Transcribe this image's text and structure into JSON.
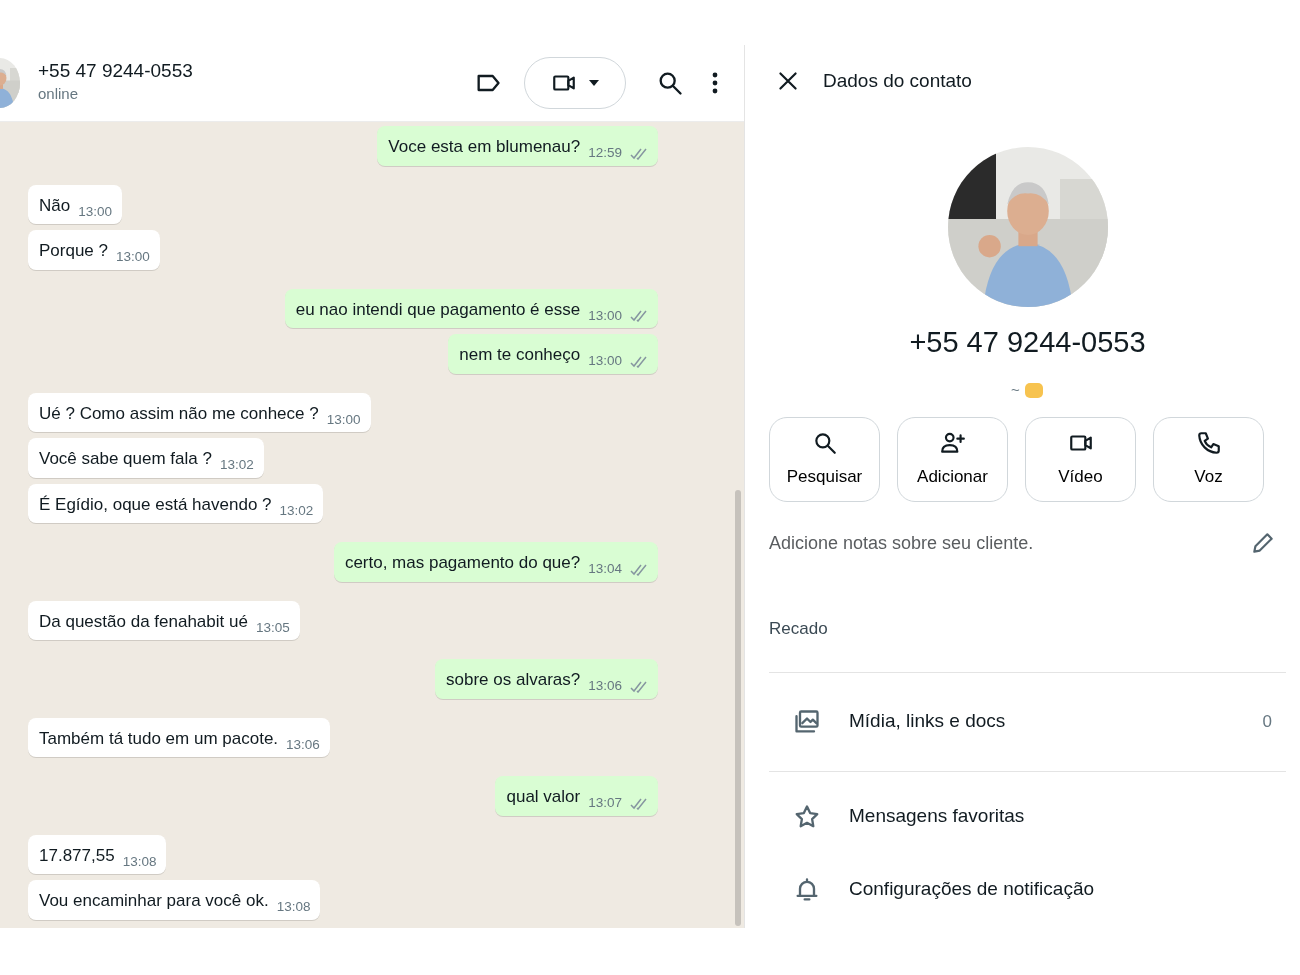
{
  "chat_header": {
    "contact": "+55 47 9244-0553",
    "status": "online"
  },
  "messages": [
    {
      "kind": "outgoing",
      "text": "Voce esta em blumenau?",
      "time": "12:59",
      "read": false
    },
    {
      "kind": "incoming",
      "text": "Não",
      "time": "13:00"
    },
    {
      "kind": "incoming",
      "text": "Porque ?",
      "time": "13:00"
    },
    {
      "kind": "outgoing",
      "text": "eu nao intendi que pagamento é esse",
      "time": "13:00",
      "read": false
    },
    {
      "kind": "outgoing",
      "text": "nem te conheço",
      "time": "13:00",
      "read": false
    },
    {
      "kind": "incoming",
      "text": "Ué ? Como assim não me conhece ?",
      "time": "13:00"
    },
    {
      "kind": "incoming",
      "text": "Você sabe quem fala ?",
      "time": "13:02"
    },
    {
      "kind": "incoming",
      "text": "É Egídio, oque está havendo ?",
      "time": "13:02"
    },
    {
      "kind": "outgoing",
      "text": "certo, mas pagamento do que?",
      "time": "13:04",
      "read": false
    },
    {
      "kind": "incoming",
      "text": "Da questão da fenahabit ué",
      "time": "13:05"
    },
    {
      "kind": "outgoing",
      "text": "sobre os alvaras?",
      "time": "13:06",
      "read": false
    },
    {
      "kind": "incoming",
      "text": "Também tá tudo em um pacote.",
      "time": "13:06"
    },
    {
      "kind": "outgoing",
      "text": "qual valor",
      "time": "13:07",
      "read": false
    },
    {
      "kind": "incoming",
      "text": "17.877,55",
      "time": "13:08"
    },
    {
      "kind": "incoming",
      "text": "Vou encaminhar para você ok.",
      "time": "13:08"
    }
  ],
  "contact_panel": {
    "title": "Dados do contato",
    "phone": "+55 47 9244-0553",
    "about": "~",
    "actions": [
      {
        "kind": "search",
        "label": "Pesquisar"
      },
      {
        "kind": "add",
        "label": "Adicionar"
      },
      {
        "kind": "video",
        "label": "Vídeo"
      },
      {
        "kind": "voice",
        "label": "Voz"
      }
    ],
    "notes": {
      "placeholder": "Adicione notas sobre seu cliente."
    },
    "section_label": "Recado",
    "items": [
      {
        "kind": "media",
        "label": "Mídia, links e docs",
        "count": "0"
      },
      {
        "kind": "star",
        "label": "Mensagens favoritas"
      },
      {
        "kind": "bell",
        "label": "Configurações de notificação"
      }
    ]
  }
}
